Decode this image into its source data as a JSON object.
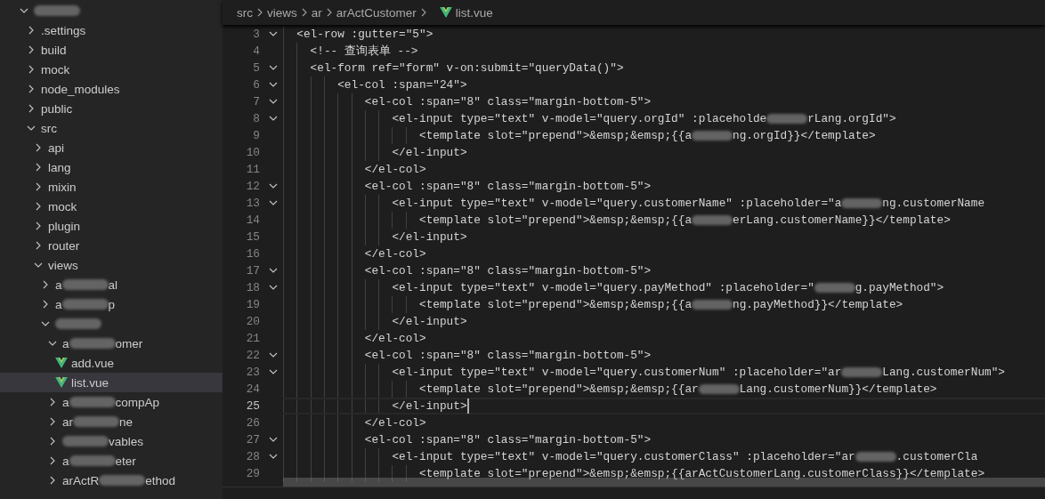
{
  "explorer": {
    "tree": [
      {
        "kind": "folder",
        "parts": [
          {
            "kind": "redacted"
          }
        ],
        "expanded": true,
        "selected": false,
        "children": [
          {
            "kind": "folder",
            "parts": [
              {
                "kind": "text",
                "text": ".settings"
              }
            ],
            "expanded": false,
            "selected": false
          },
          {
            "kind": "folder",
            "parts": [
              {
                "kind": "text",
                "text": "build"
              }
            ],
            "expanded": false,
            "selected": false
          },
          {
            "kind": "folder",
            "parts": [
              {
                "kind": "text",
                "text": "mock"
              }
            ],
            "expanded": false,
            "selected": false
          },
          {
            "kind": "folder",
            "parts": [
              {
                "kind": "text",
                "text": "node_modules"
              }
            ],
            "expanded": false,
            "selected": false
          },
          {
            "kind": "folder",
            "parts": [
              {
                "kind": "text",
                "text": "public"
              }
            ],
            "expanded": false,
            "selected": false
          },
          {
            "kind": "folder",
            "parts": [
              {
                "kind": "text",
                "text": "src"
              }
            ],
            "expanded": true,
            "selected": false,
            "children": [
              {
                "kind": "folder",
                "parts": [
                  {
                    "kind": "text",
                    "text": "api"
                  }
                ],
                "expanded": false,
                "selected": false
              },
              {
                "kind": "folder",
                "parts": [
                  {
                    "kind": "text",
                    "text": "lang"
                  }
                ],
                "expanded": false,
                "selected": false
              },
              {
                "kind": "folder",
                "parts": [
                  {
                    "kind": "text",
                    "text": "mixin"
                  }
                ],
                "expanded": false,
                "selected": false
              },
              {
                "kind": "folder",
                "parts": [
                  {
                    "kind": "text",
                    "text": "mock"
                  }
                ],
                "expanded": false,
                "selected": false
              },
              {
                "kind": "folder",
                "parts": [
                  {
                    "kind": "text",
                    "text": "plugin"
                  }
                ],
                "expanded": false,
                "selected": false
              },
              {
                "kind": "folder",
                "parts": [
                  {
                    "kind": "text",
                    "text": "router"
                  }
                ],
                "expanded": false,
                "selected": false
              },
              {
                "kind": "folder",
                "parts": [
                  {
                    "kind": "text",
                    "text": "views"
                  }
                ],
                "expanded": true,
                "selected": false,
                "children": [
                  {
                    "kind": "folder",
                    "parts": [
                      {
                        "kind": "text",
                        "text": "a"
                      },
                      {
                        "kind": "redacted"
                      },
                      {
                        "kind": "text",
                        "text": "al"
                      }
                    ],
                    "expanded": false,
                    "selected": false
                  },
                  {
                    "kind": "folder",
                    "parts": [
                      {
                        "kind": "text",
                        "text": "a"
                      },
                      {
                        "kind": "redacted"
                      },
                      {
                        "kind": "text",
                        "text": "p"
                      }
                    ],
                    "expanded": false,
                    "selected": false
                  },
                  {
                    "kind": "folder",
                    "parts": [
                      {
                        "kind": "redacted"
                      }
                    ],
                    "expanded": true,
                    "selected": false,
                    "children": [
                      {
                        "kind": "folder",
                        "parts": [
                          {
                            "kind": "text",
                            "text": "a"
                          },
                          {
                            "kind": "redacted"
                          },
                          {
                            "kind": "text",
                            "text": "omer"
                          }
                        ],
                        "expanded": true,
                        "selected": false,
                        "children": [
                          {
                            "kind": "file",
                            "parts": [
                              {
                                "kind": "text",
                                "text": "add.vue"
                              }
                            ],
                            "selected": false
                          },
                          {
                            "kind": "file",
                            "parts": [
                              {
                                "kind": "text",
                                "text": "list.vue"
                              }
                            ],
                            "selected": true
                          }
                        ]
                      },
                      {
                        "kind": "folder",
                        "parts": [
                          {
                            "kind": "text",
                            "text": "a"
                          },
                          {
                            "kind": "redacted"
                          },
                          {
                            "kind": "text",
                            "text": "compAp"
                          }
                        ],
                        "expanded": false,
                        "selected": false
                      },
                      {
                        "kind": "folder",
                        "parts": [
                          {
                            "kind": "text",
                            "text": "ar"
                          },
                          {
                            "kind": "redacted"
                          },
                          {
                            "kind": "text",
                            "text": "ne"
                          }
                        ],
                        "expanded": false,
                        "selected": false
                      },
                      {
                        "kind": "folder",
                        "parts": [
                          {
                            "kind": "redacted"
                          },
                          {
                            "kind": "text",
                            "text": "vables"
                          }
                        ],
                        "expanded": false,
                        "selected": false
                      },
                      {
                        "kind": "folder",
                        "parts": [
                          {
                            "kind": "text",
                            "text": "a"
                          },
                          {
                            "kind": "redacted"
                          },
                          {
                            "kind": "text",
                            "text": "eter"
                          }
                        ],
                        "expanded": false,
                        "selected": false
                      },
                      {
                        "kind": "folder",
                        "parts": [
                          {
                            "kind": "text",
                            "text": "arActR"
                          },
                          {
                            "kind": "redacted"
                          },
                          {
                            "kind": "text",
                            "text": "ethod"
                          }
                        ],
                        "expanded": false,
                        "selected": false
                      }
                    ]
                  }
                ]
              }
            ]
          }
        ]
      }
    ]
  },
  "breadcrumb": {
    "parts": [
      "src",
      "views",
      "ar",
      "arActCustomer"
    ],
    "file": "list.vue"
  },
  "editor": {
    "lines": [
      {
        "number": "3",
        "foldable": true,
        "current": false,
        "parts": [
          {
            "kind": "text",
            "text": "  <el-row :gutter=\"5\">"
          }
        ]
      },
      {
        "number": "4",
        "foldable": false,
        "current": false,
        "parts": [
          {
            "kind": "text",
            "text": "    <!-- 查询表单 -->"
          }
        ]
      },
      {
        "number": "5",
        "foldable": true,
        "current": false,
        "parts": [
          {
            "kind": "text",
            "text": "    <el-form ref=\"form\" v-on:submit=\"queryData()\">"
          }
        ]
      },
      {
        "number": "6",
        "foldable": true,
        "current": false,
        "parts": [
          {
            "kind": "text",
            "text": "        <el-col :span=\"24\">"
          }
        ]
      },
      {
        "number": "7",
        "foldable": true,
        "current": false,
        "parts": [
          {
            "kind": "text",
            "text": "            <el-col :span=\"8\" class=\"margin-bottom-5\">"
          }
        ]
      },
      {
        "number": "8",
        "foldable": true,
        "current": false,
        "parts": [
          {
            "kind": "text",
            "text": "                <el-input type=\"text\" v-model=\"query.orgId\" :placeholde"
          },
          {
            "kind": "redacted"
          },
          {
            "kind": "text",
            "text": "rLang.orgId\">"
          }
        ]
      },
      {
        "number": "9",
        "foldable": false,
        "current": false,
        "parts": [
          {
            "kind": "text",
            "text": "                    <template slot=\"prepend\">&emsp;&emsp;{{a"
          },
          {
            "kind": "redacted"
          },
          {
            "kind": "text",
            "text": "ng.orgId}}</template>"
          }
        ]
      },
      {
        "number": "10",
        "foldable": false,
        "current": false,
        "parts": [
          {
            "kind": "text",
            "text": "                </el-input>"
          }
        ]
      },
      {
        "number": "11",
        "foldable": false,
        "current": false,
        "parts": [
          {
            "kind": "text",
            "text": "            </el-col>"
          }
        ]
      },
      {
        "number": "12",
        "foldable": true,
        "current": false,
        "parts": [
          {
            "kind": "text",
            "text": "            <el-col :span=\"8\" class=\"margin-bottom-5\">"
          }
        ]
      },
      {
        "number": "13",
        "foldable": true,
        "current": false,
        "parts": [
          {
            "kind": "text",
            "text": "                <el-input type=\"text\" v-model=\"query.customerName\" :placeholder=\"a"
          },
          {
            "kind": "redacted"
          },
          {
            "kind": "text",
            "text": "ng.customerName"
          }
        ]
      },
      {
        "number": "14",
        "foldable": false,
        "current": false,
        "parts": [
          {
            "kind": "text",
            "text": "                    <template slot=\"prepend\">&emsp;&emsp;{{a"
          },
          {
            "kind": "redacted"
          },
          {
            "kind": "text",
            "text": "erLang.customerName}}</template>"
          }
        ]
      },
      {
        "number": "15",
        "foldable": false,
        "current": false,
        "parts": [
          {
            "kind": "text",
            "text": "                </el-input>"
          }
        ]
      },
      {
        "number": "16",
        "foldable": false,
        "current": false,
        "parts": [
          {
            "kind": "text",
            "text": "            </el-col>"
          }
        ]
      },
      {
        "number": "17",
        "foldable": true,
        "current": false,
        "parts": [
          {
            "kind": "text",
            "text": "            <el-col :span=\"8\" class=\"margin-bottom-5\">"
          }
        ]
      },
      {
        "number": "18",
        "foldable": true,
        "current": false,
        "parts": [
          {
            "kind": "text",
            "text": "                <el-input type=\"text\" v-model=\"query.payMethod\" :placeholder=\""
          },
          {
            "kind": "redacted"
          },
          {
            "kind": "text",
            "text": "g.payMethod\">"
          }
        ]
      },
      {
        "number": "19",
        "foldable": false,
        "current": false,
        "parts": [
          {
            "kind": "text",
            "text": "                    <template slot=\"prepend\">&emsp;&emsp;{{a"
          },
          {
            "kind": "redacted"
          },
          {
            "kind": "text",
            "text": "ng.payMethod}}</template>"
          }
        ]
      },
      {
        "number": "20",
        "foldable": false,
        "current": false,
        "parts": [
          {
            "kind": "text",
            "text": "                </el-input>"
          }
        ]
      },
      {
        "number": "21",
        "foldable": false,
        "current": false,
        "parts": [
          {
            "kind": "text",
            "text": "            </el-col>"
          }
        ]
      },
      {
        "number": "22",
        "foldable": true,
        "current": false,
        "parts": [
          {
            "kind": "text",
            "text": "            <el-col :span=\"8\" class=\"margin-bottom-5\">"
          }
        ]
      },
      {
        "number": "23",
        "foldable": true,
        "current": false,
        "parts": [
          {
            "kind": "text",
            "text": "                <el-input type=\"text\" v-model=\"query.customerNum\" :placeholder=\"ar"
          },
          {
            "kind": "redacted"
          },
          {
            "kind": "text",
            "text": "Lang.customerNum\">"
          }
        ]
      },
      {
        "number": "24",
        "foldable": false,
        "current": false,
        "parts": [
          {
            "kind": "text",
            "text": "                    <template slot=\"prepend\">&emsp;&emsp;{{ar"
          },
          {
            "kind": "redacted"
          },
          {
            "kind": "text",
            "text": "Lang.customerNum}}</template>"
          }
        ]
      },
      {
        "number": "25",
        "foldable": false,
        "current": true,
        "parts": [
          {
            "kind": "text",
            "text": "                </el-input>"
          }
        ]
      },
      {
        "number": "26",
        "foldable": false,
        "current": false,
        "parts": [
          {
            "kind": "text",
            "text": "            </el-col>"
          }
        ]
      },
      {
        "number": "27",
        "foldable": true,
        "current": false,
        "parts": [
          {
            "kind": "text",
            "text": "            <el-col :span=\"8\" class=\"margin-bottom-5\">"
          }
        ]
      },
      {
        "number": "28",
        "foldable": true,
        "current": false,
        "parts": [
          {
            "kind": "text",
            "text": "                <el-input type=\"text\" v-model=\"query.customerClass\" :placeholder=\"ar"
          },
          {
            "kind": "redacted"
          },
          {
            "kind": "text",
            "text": ".customerCla"
          }
        ]
      },
      {
        "number": "29",
        "foldable": false,
        "current": false,
        "parts": [
          {
            "kind": "text",
            "text": "                    <template slot=\"prepend\">&emsp;&emsp;{{arActCustomerLang.customerClass}}</template>"
          }
        ]
      }
    ]
  }
}
